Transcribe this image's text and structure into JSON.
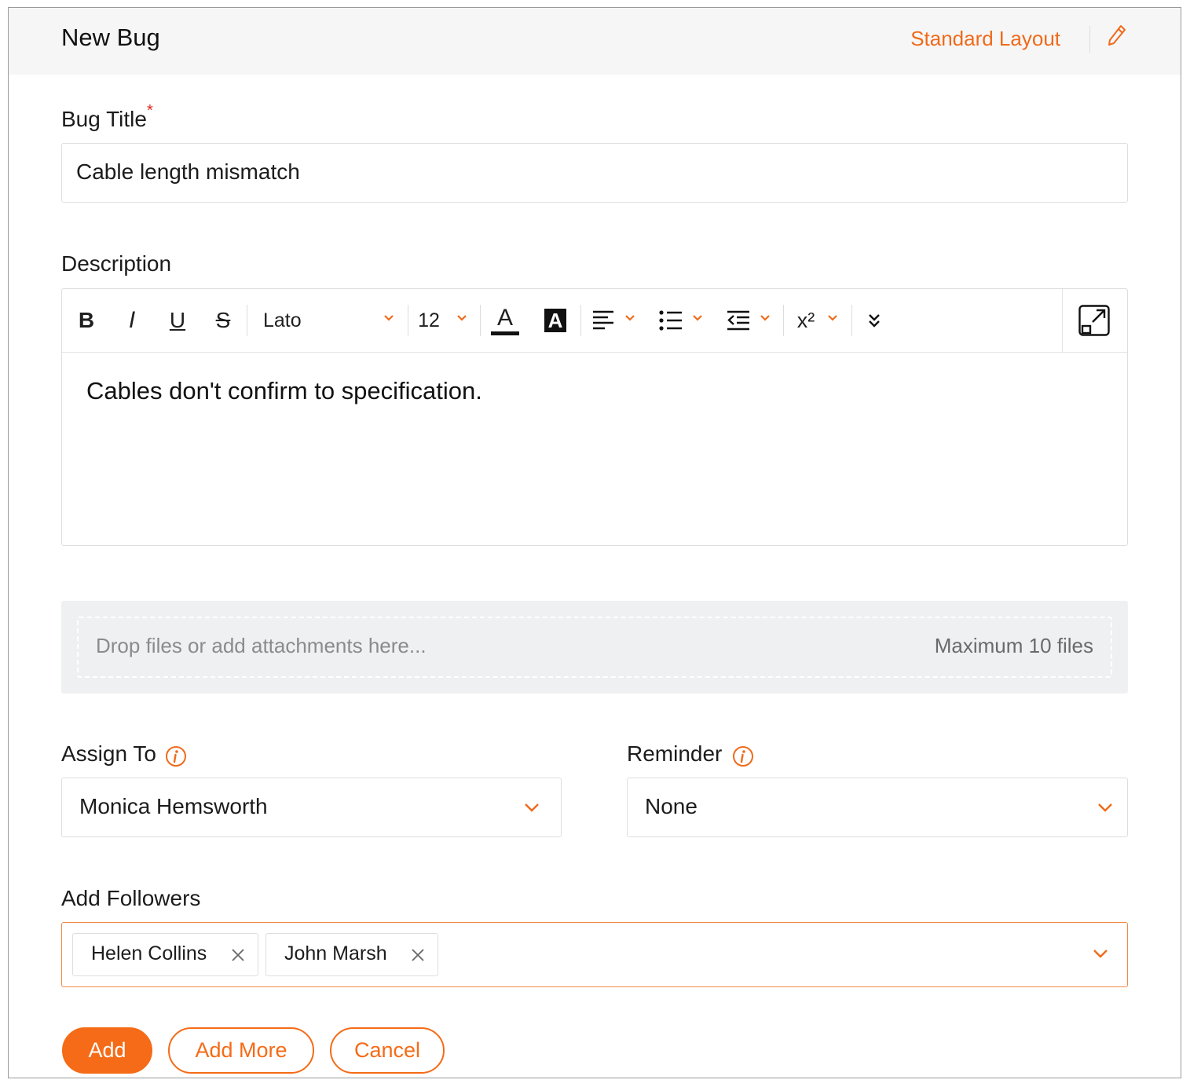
{
  "header": {
    "title": "New Bug",
    "layout_link": "Standard Layout",
    "edit_icon": "pencil-icon"
  },
  "bug_title": {
    "label": "Bug Title",
    "required_mark": "*",
    "value": "Cable length mismatch"
  },
  "description": {
    "label": "Description",
    "toolbar": {
      "bold": "B",
      "italic": "I",
      "underline": "U",
      "strike": "S",
      "font_family": "Lato",
      "font_size": "12",
      "font_color": "A",
      "bg_color": "A",
      "superscript": "x²"
    },
    "content": "Cables don't confirm to specification."
  },
  "attachments": {
    "hint": "Drop files or add attachments here...",
    "max": "Maximum 10 files"
  },
  "assign_to": {
    "label": "Assign To",
    "value": "Monica Hemsworth"
  },
  "reminder": {
    "label": "Reminder",
    "value": "None"
  },
  "followers": {
    "label": "Add Followers",
    "chips": [
      "Helen Collins",
      "John Marsh"
    ]
  },
  "actions": {
    "add": "Add",
    "add_more": "Add More",
    "cancel": "Cancel"
  },
  "colors": {
    "accent": "#f56b17",
    "required": "#e0251d"
  }
}
